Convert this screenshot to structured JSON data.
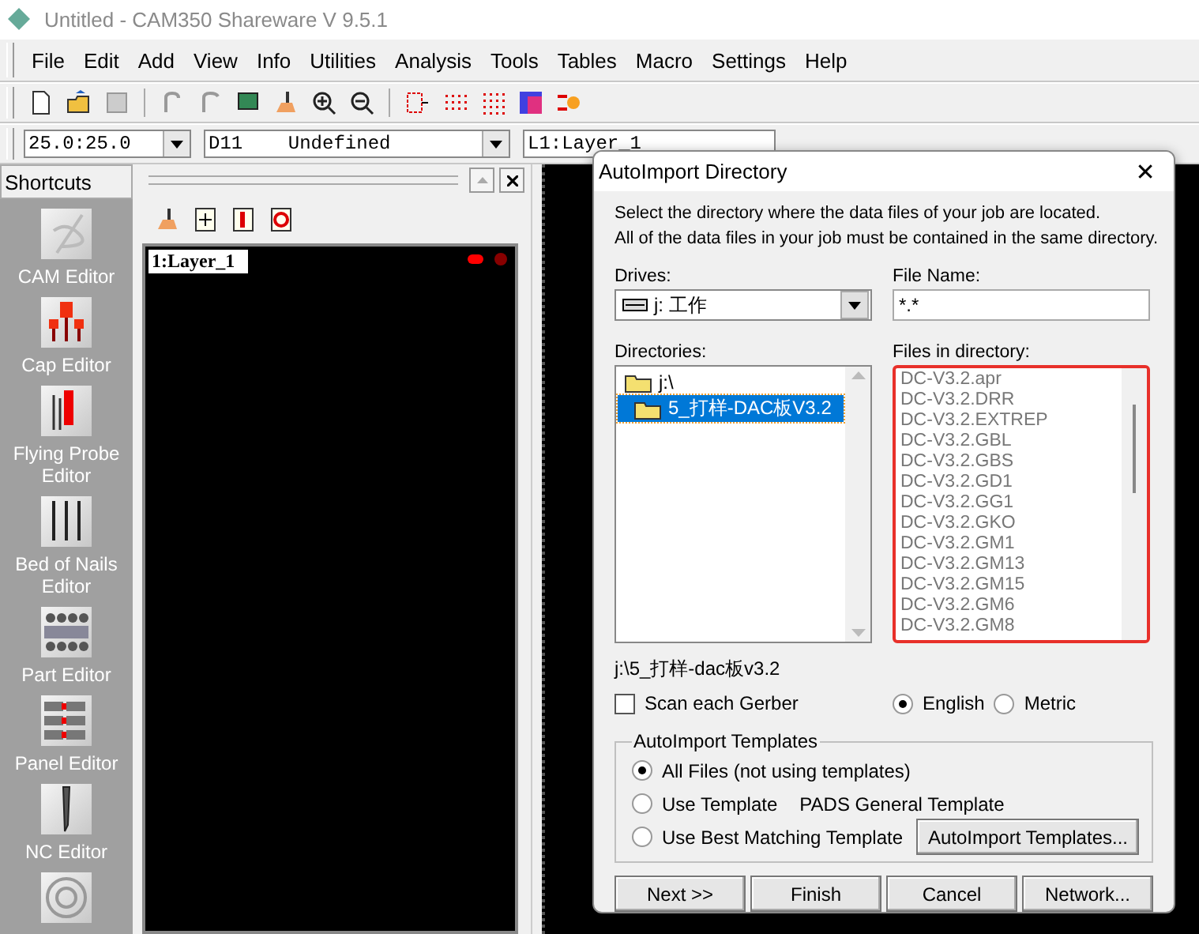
{
  "window": {
    "title": "Untitled - CAM350 Shareware V 9.5.1"
  },
  "menu": [
    "File",
    "Edit",
    "Add",
    "View",
    "Info",
    "Utilities",
    "Analysis",
    "Tools",
    "Tables",
    "Macro",
    "Settings",
    "Help"
  ],
  "combos": [
    {
      "value": "25.0:25.0"
    },
    {
      "value": "D11    Undefined"
    },
    {
      "value": "L1:Layer_1"
    }
  ],
  "shortcuts": {
    "title": "Shortcuts",
    "items": [
      {
        "label": "CAM Editor"
      },
      {
        "label": "Cap Editor"
      },
      {
        "label": "Flying Probe Editor"
      },
      {
        "label": "Bed of Nails Editor"
      },
      {
        "label": "Part Editor"
      },
      {
        "label": "Panel Editor"
      },
      {
        "label": "NC Editor"
      }
    ]
  },
  "layer_panel": {
    "layer_label": "1:Layer_1"
  },
  "dialog": {
    "title": "AutoImport Directory",
    "close": "✕",
    "instructions": [
      "Select the directory where the data files of your job are located.",
      "All of the data files in your job must be contained in the same directory."
    ],
    "drives": {
      "label": "Drives:",
      "value": "j: 工作"
    },
    "file_name": {
      "label": "File Name:",
      "value": "*.*"
    },
    "directories": {
      "label": "Directories:",
      "items": [
        {
          "label": "j:\\",
          "selected": false,
          "children": [
            {
              "label": "5_打样-DAC板V3.2",
              "selected": true
            }
          ]
        }
      ]
    },
    "files": {
      "label": "Files in directory:",
      "items": [
        "DC-V3.2.apr",
        "DC-V3.2.DRR",
        "DC-V3.2.EXTREP",
        "DC-V3.2.GBL",
        "DC-V3.2.GBS",
        "DC-V3.2.GD1",
        "DC-V3.2.GG1",
        "DC-V3.2.GKO",
        "DC-V3.2.GM1",
        "DC-V3.2.GM13",
        "DC-V3.2.GM15",
        "DC-V3.2.GM6",
        "DC-V3.2.GM8"
      ]
    },
    "path": "j:\\5_打样-dac板v3.2",
    "scan_each_gerber": {
      "label": "Scan each Gerber",
      "checked": false
    },
    "units": [
      {
        "label": "English",
        "selected": true
      },
      {
        "label": "Metric",
        "selected": false
      }
    ],
    "templates": {
      "title": "AutoImport Templates",
      "options": [
        {
          "label": "All Files (not using templates)",
          "selected": true
        },
        {
          "label": "Use Template",
          "selected": false,
          "value": "PADS General Template"
        },
        {
          "label": "Use Best Matching Template",
          "selected": false
        }
      ],
      "button": "AutoImport Templates..."
    },
    "buttons": [
      "Next >>",
      "Finish",
      "Cancel",
      "Network..."
    ]
  }
}
